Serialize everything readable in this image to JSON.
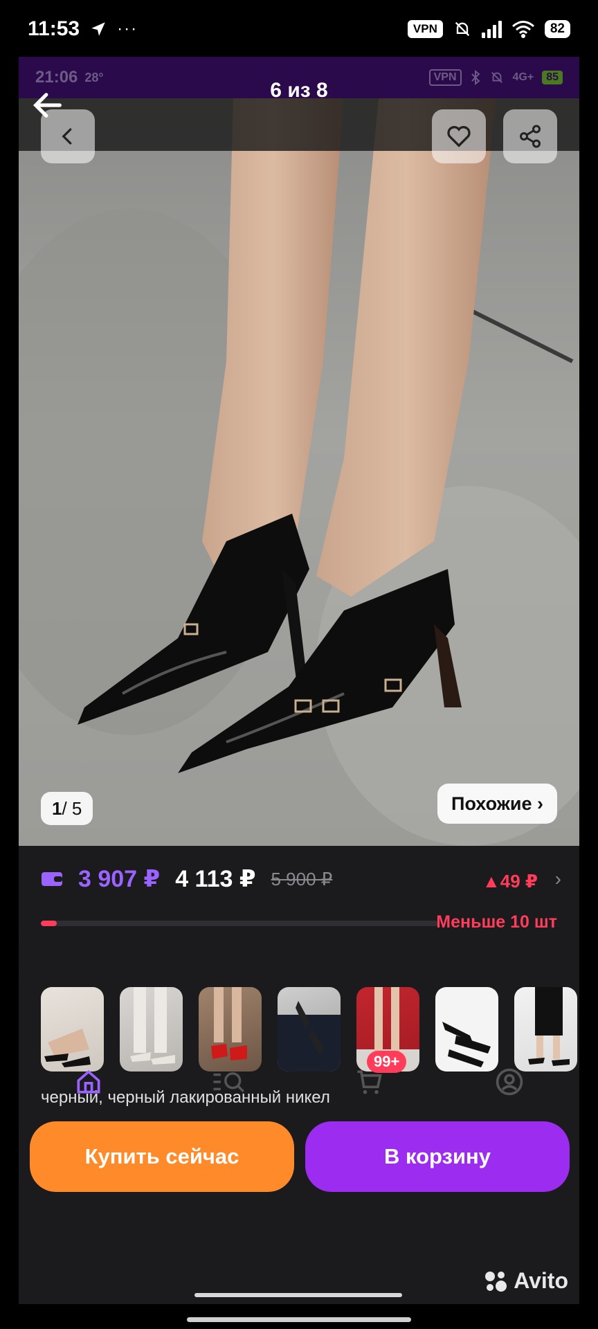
{
  "status_bar": {
    "time": "11:53",
    "vpn": "VPN",
    "battery": "82"
  },
  "inner_status": {
    "time": "21:06",
    "temp": "28°",
    "vpn": "VPN",
    "network": "4G+",
    "battery": "85"
  },
  "viewer": {
    "title": "6 из 8"
  },
  "photo": {
    "counter_current": "1",
    "counter_total": "/ 5",
    "similar_label": "Похожие ›"
  },
  "price": {
    "wallet_price": "3 907 ₽",
    "price": "4 113 ₽",
    "old_price": "5 900 ₽",
    "change": "▲49 ₽",
    "stock_label": "Меньше 10 шт",
    "stock_fraction": 0.04
  },
  "variants": {
    "label": "черный, черный лакированный никел",
    "thumbnails": [
      "thumb-1",
      "thumb-2",
      "thumb-3",
      "thumb-4",
      "thumb-5",
      "thumb-6",
      "thumb-7"
    ]
  },
  "actions": {
    "buy_now": "Купить сейчас",
    "add_to_cart": "В корзину"
  },
  "nav": {
    "cart_badge": "99+"
  },
  "brand": {
    "logo_text": "Avito"
  },
  "colors": {
    "accent_purple": "#9b63ff",
    "buy_orange": "#ff8a2a",
    "cart_purple": "#9b2cf0",
    "alert_red": "#ff3d5a"
  }
}
